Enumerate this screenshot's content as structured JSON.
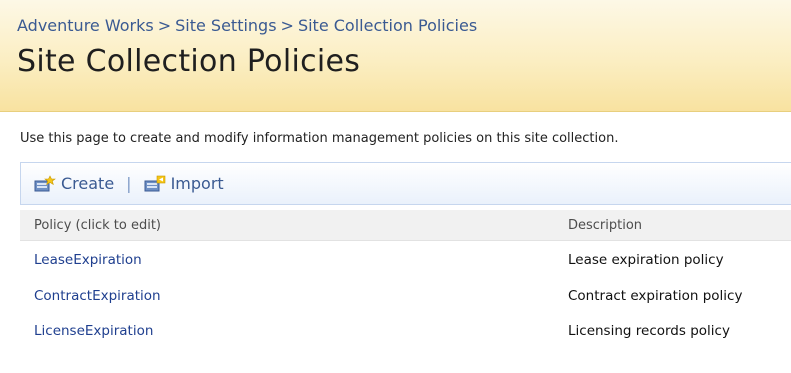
{
  "breadcrumb": {
    "items": [
      "Adventure Works",
      "Site Settings",
      "Site Collection Policies"
    ],
    "separator": ">"
  },
  "page_title": "Site Collection Policies",
  "intro_text": "Use this page to create and modify information management policies on this site collection.",
  "toolbar": {
    "create_label": "Create",
    "separator": "|",
    "import_label": "Import"
  },
  "table": {
    "headers": [
      "Policy (click to edit)",
      "Description"
    ],
    "rows": [
      {
        "policy": "LeaseExpiration",
        "description": "Lease expiration policy"
      },
      {
        "policy": "ContractExpiration",
        "description": "Contract expiration policy"
      },
      {
        "policy": "LicenseExpiration",
        "description": "Licensing records policy"
      }
    ]
  },
  "colors": {
    "header_bg": "#fbeec2",
    "link": "#1f3f8f",
    "breadcrumb": "#3a5a92",
    "toolbar_border": "#c6d6ee"
  },
  "icons": {
    "create": "new-document-icon",
    "import": "import-document-icon"
  }
}
